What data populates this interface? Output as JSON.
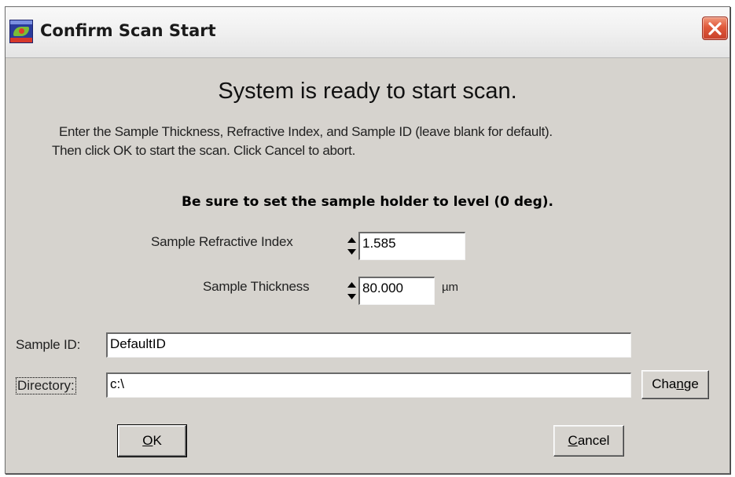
{
  "window": {
    "title": "Confirm Scan Start",
    "icon": "app-icon",
    "close_icon": "close-x-icon",
    "close_color": "#d94a2f"
  },
  "dialog": {
    "heading": "System is ready to start scan.",
    "instructions_line1": "Enter the Sample Thickness, Refractive Index,  and Sample ID (leave blank for default).",
    "instructions_line2": "Then click OK to start the scan.  Click Cancel to abort.",
    "warning": "Be sure to set the sample holder to level (0 deg)."
  },
  "refractive_index": {
    "label": "Sample Refractive Index",
    "value": "1.585",
    "spinner_icon": "up-down-arrows-icon"
  },
  "thickness": {
    "label": "Sample Thickness",
    "value": "80.000",
    "unit": "µm",
    "spinner_icon": "up-down-arrows-icon"
  },
  "sample_id": {
    "label": "Sample ID:",
    "value": "DefaultID"
  },
  "directory": {
    "label": "Directory:",
    "value": "c:\\",
    "change_prefix": "Cha",
    "change_mnemonic": "n",
    "change_suffix": "ge"
  },
  "buttons": {
    "ok_mnemonic": "O",
    "ok_suffix": "K",
    "cancel_mnemonic": "C",
    "cancel_suffix": "ancel"
  }
}
